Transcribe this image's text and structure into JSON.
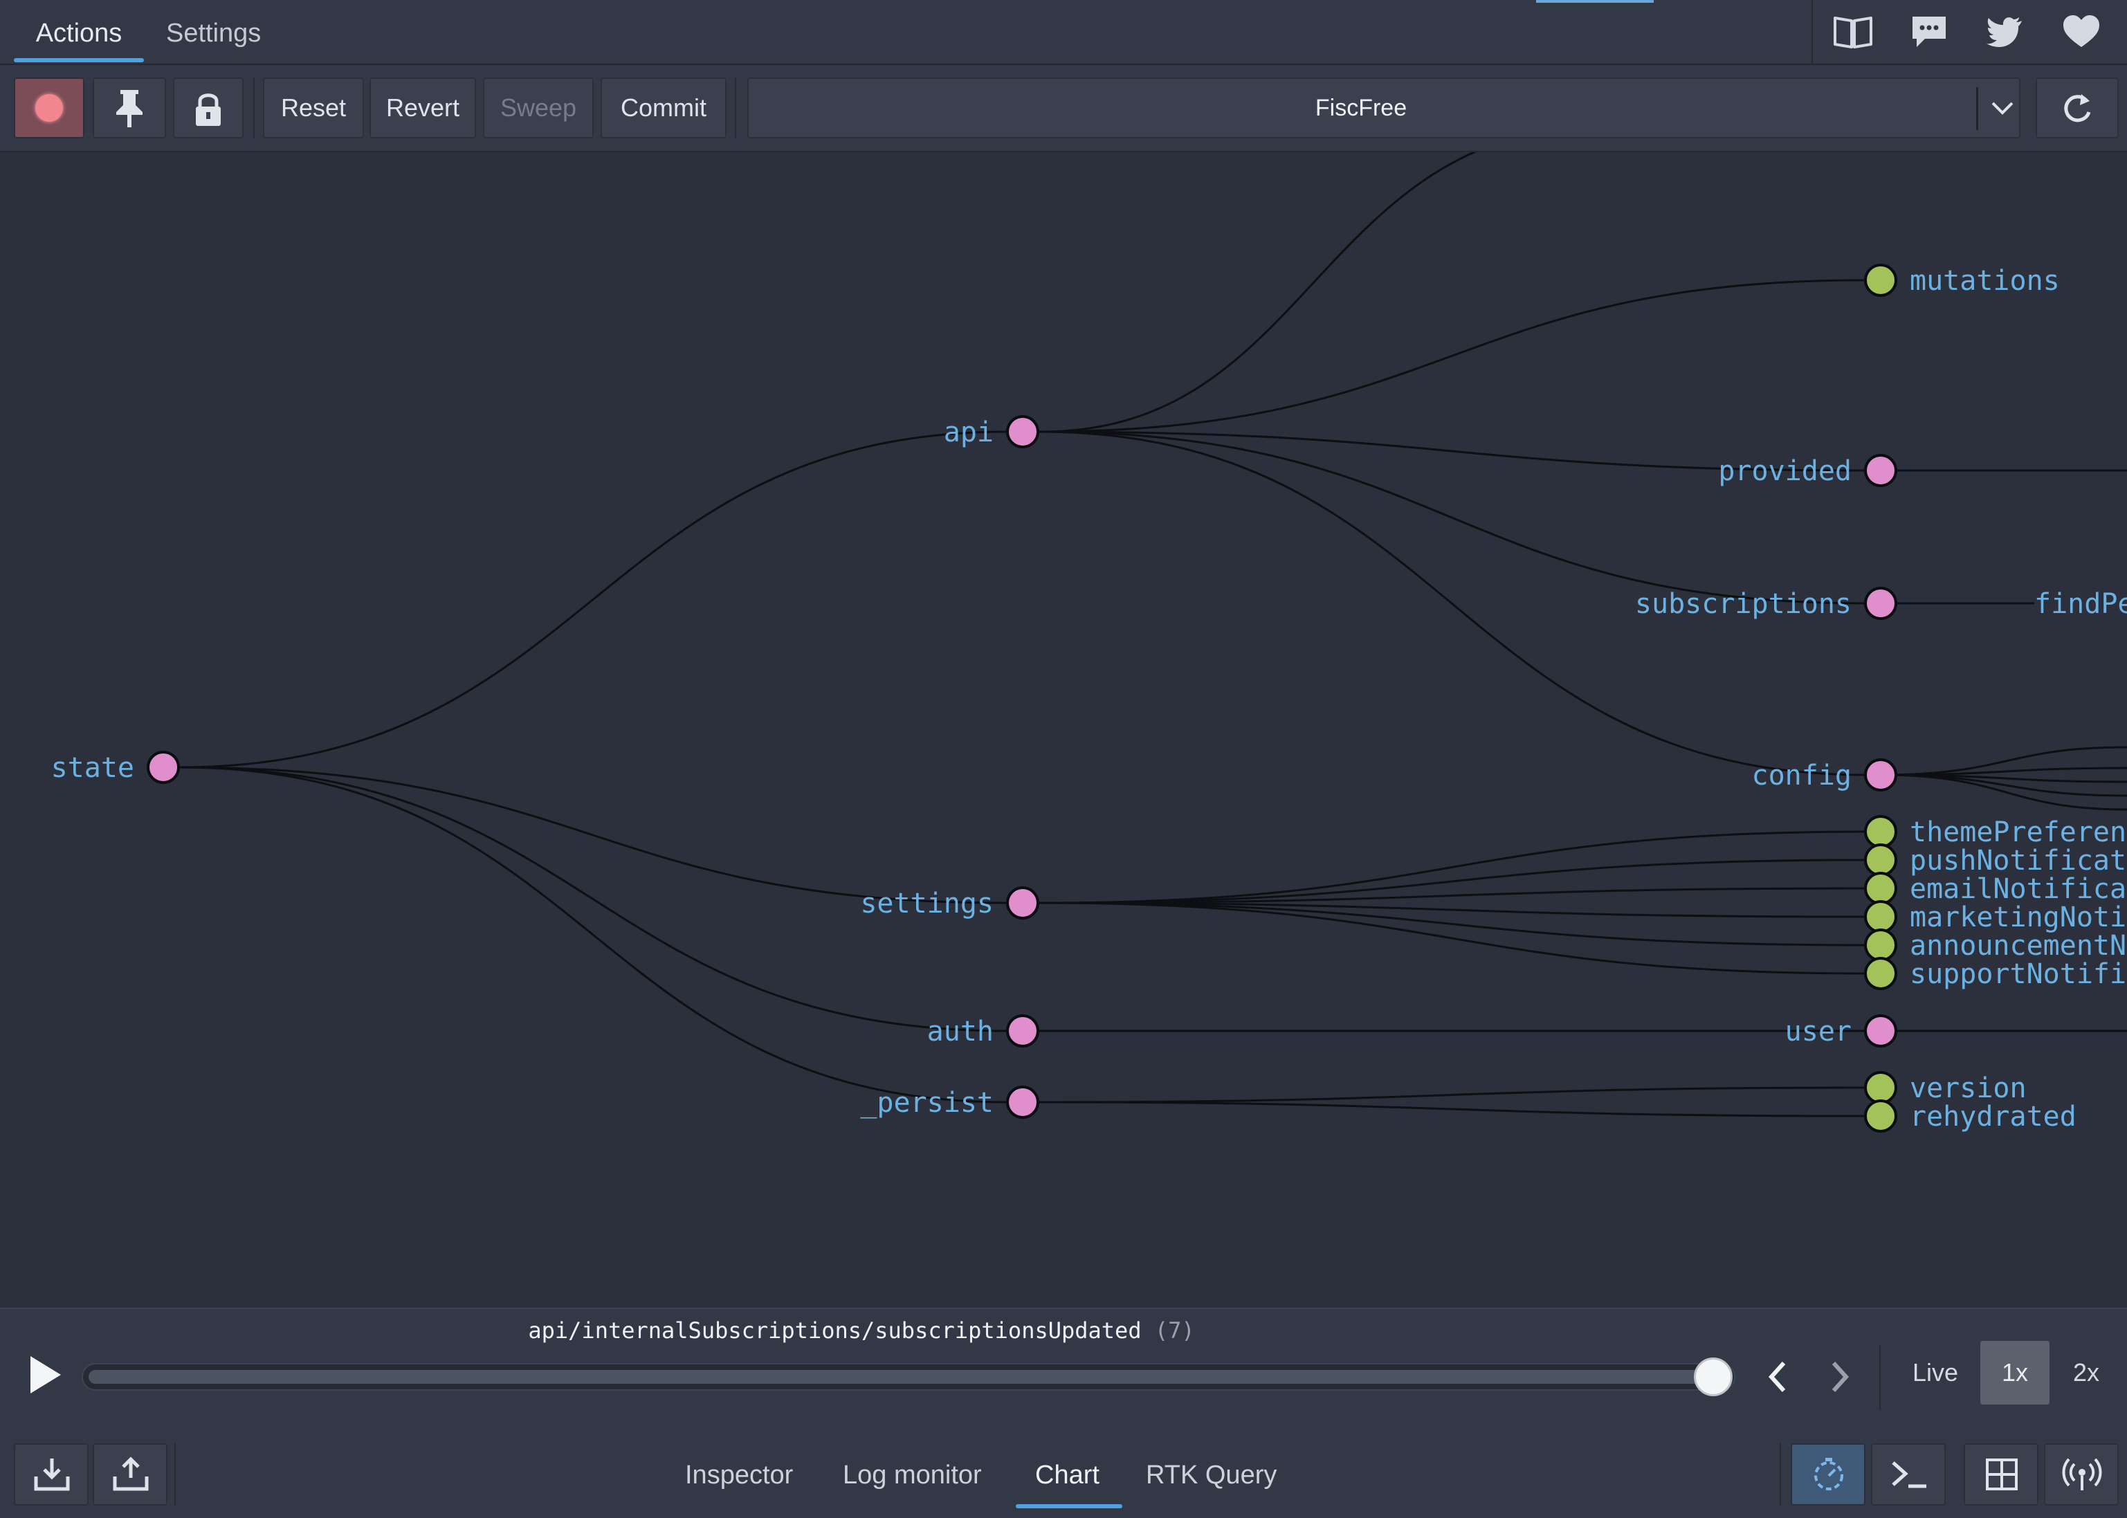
{
  "top_tabs": {
    "actions": "Actions",
    "settings": "Settings"
  },
  "toolbar": {
    "reset": "Reset",
    "revert": "Revert",
    "sweep": "Sweep",
    "commit": "Commit",
    "instance": "FiscFree"
  },
  "tree": {
    "nodes": [
      {
        "id": "state",
        "label": "state",
        "type": "branch"
      },
      {
        "id": "api",
        "label": "api",
        "type": "branch"
      },
      {
        "id": "settings",
        "label": "settings",
        "type": "branch"
      },
      {
        "id": "auth",
        "label": "auth",
        "type": "branch"
      },
      {
        "id": "persist",
        "label": "_persist",
        "type": "branch"
      },
      {
        "id": "mutations",
        "label": "mutations",
        "type": "leaf"
      },
      {
        "id": "provided",
        "label": "provided",
        "type": "branch"
      },
      {
        "id": "subscriptions",
        "label": "subscriptions",
        "type": "branch"
      },
      {
        "id": "config",
        "label": "config",
        "type": "branch"
      },
      {
        "id": "themePreference",
        "label": "themePreferen",
        "type": "leaf"
      },
      {
        "id": "pushNotifications",
        "label": "pushNotificat",
        "type": "leaf"
      },
      {
        "id": "emailNotifications",
        "label": "emailNotifica",
        "type": "leaf"
      },
      {
        "id": "marketingNotifications",
        "label": "marketingNoti",
        "type": "leaf"
      },
      {
        "id": "announcementNotifications",
        "label": "announcementN",
        "type": "leaf"
      },
      {
        "id": "supportNotifications",
        "label": "supportNotifi",
        "type": "leaf"
      },
      {
        "id": "user",
        "label": "user",
        "type": "branch"
      },
      {
        "id": "version",
        "label": "version",
        "type": "leaf"
      },
      {
        "id": "rehydrated",
        "label": "rehydrated",
        "type": "leaf"
      },
      {
        "id": "findPe",
        "label": "findPe",
        "type": "text"
      }
    ],
    "links": [
      [
        "state",
        "api"
      ],
      [
        "state",
        "settings"
      ],
      [
        "state",
        "auth"
      ],
      [
        "state",
        "persist"
      ],
      [
        "api",
        "mutations"
      ],
      [
        "api",
        "provided"
      ],
      [
        "api",
        "subscriptions"
      ],
      [
        "api",
        "config"
      ],
      [
        "settings",
        "themePreference"
      ],
      [
        "settings",
        "pushNotifications"
      ],
      [
        "settings",
        "emailNotifications"
      ],
      [
        "settings",
        "marketingNotifications"
      ],
      [
        "settings",
        "announcementNotifications"
      ],
      [
        "settings",
        "supportNotifications"
      ],
      [
        "auth",
        "user"
      ],
      [
        "persist",
        "version"
      ],
      [
        "persist",
        "rehydrated"
      ]
    ],
    "colors": {
      "branch": "#e08fcc",
      "leaf": "#a3c35a",
      "link": "#0d0f13",
      "label": "#6bb2e3"
    }
  },
  "slider": {
    "action_name": "api/internalSubscriptions/subscriptionsUpdated",
    "action_count": "(7)",
    "position": 1.0,
    "speeds": {
      "live": "Live",
      "x1": "1x",
      "x2": "2x"
    }
  },
  "monitor_tabs": {
    "inspector": "Inspector",
    "log_monitor": "Log monitor",
    "chart": "Chart",
    "rtk_query": "RTK Query"
  },
  "icons": {
    "top": [
      "book-icon",
      "chat-icon",
      "twitter-icon",
      "heart-icon"
    ],
    "bottom": [
      "import-icon",
      "export-icon",
      "timer-icon",
      "terminal-icon",
      "layout-icon",
      "broadcast-icon"
    ]
  }
}
